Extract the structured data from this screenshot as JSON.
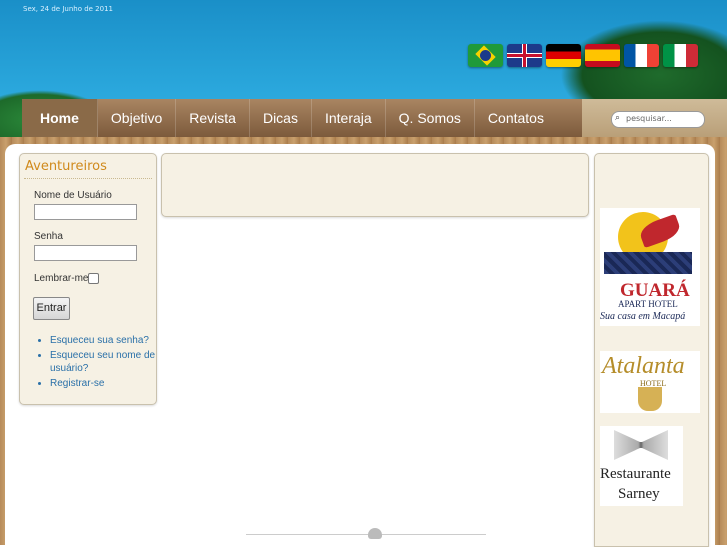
{
  "header": {
    "date": "Sex, 24 de Junho de 2011"
  },
  "flags": [
    "brazil-flag-icon",
    "uk-flag-icon",
    "germany-flag-icon",
    "spain-flag-icon",
    "france-flag-icon",
    "italy-flag-icon"
  ],
  "nav": {
    "items": [
      "Home",
      "Objetivo",
      "Revista",
      "Dicas",
      "Interaja",
      "Q. Somos",
      "Contatos"
    ]
  },
  "search": {
    "placeholder": "pesquisar..."
  },
  "login": {
    "title": "Aventureiros",
    "username_label": "Nome de Usuário",
    "password_label": "Senha",
    "remember_label": "Lembrar-me",
    "submit_label": "Entrar",
    "links": [
      "Esqueceu sua senha?",
      "Esqueceu seu nome de usuário?",
      "Registrar-se"
    ]
  },
  "sponsors": {
    "guara": {
      "name": "GUARÁ",
      "sub": "APART HOTEL",
      "slogan": "Sua casa em Macapá"
    },
    "atalanta": {
      "name": "Atalanta",
      "sub": "HOTEL"
    },
    "sarney": {
      "line1": "Restaurante",
      "line2": "Sarney"
    }
  },
  "colors": {
    "accent": "#d08a1c",
    "link": "#2a70a8",
    "nav": "#7c5a3c"
  }
}
